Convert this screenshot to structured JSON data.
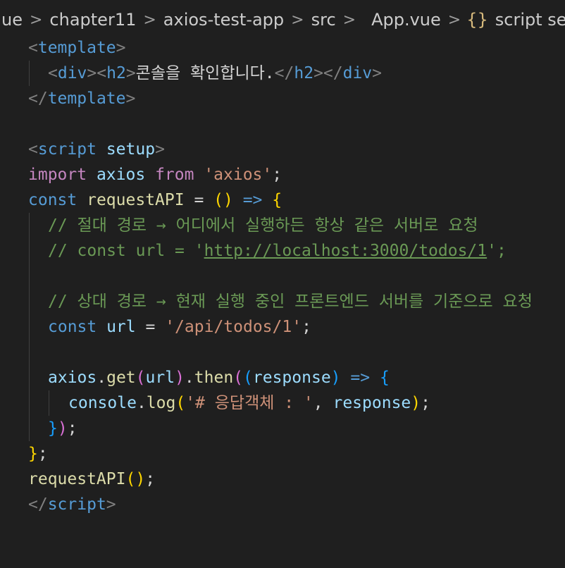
{
  "breadcrumb": {
    "items": [
      "ue",
      "chapter11",
      "axios-test-app",
      "src",
      "App.vue",
      "script se"
    ],
    "braces_icon": "{}",
    "separator": ">"
  },
  "code": {
    "template_open": "template",
    "div": "div",
    "h2": "h2",
    "heading_text": "콘솔을 확인합니다.",
    "script_tag": "script",
    "setup_attr": "setup",
    "import_kw": "import",
    "axios_var": "axios",
    "from_kw": "from",
    "axios_str": "'axios'",
    "const_kw": "const",
    "request_fn": "requestAPI",
    "comment_abs": "// 절대 경로 → 어디에서 실행하든 항상 같은 서버로 요청",
    "comment_const_prefix": "// const url = '",
    "comment_url": "http://localhost:3000/todos/1",
    "comment_const_suffix": "';",
    "comment_rel": "// 상대 경로 → 현재 실행 중인 프론트엔드 서버를 기준으로 요청",
    "url_var": "url",
    "url_str": "'/api/todos/1'",
    "get_fn": "get",
    "then_fn": "then",
    "response_var": "response",
    "console_var": "console",
    "log_fn": "log",
    "log_str": "'# 응답객체 : '"
  },
  "colors": {
    "background": "#1f1f1f",
    "tag": "#569cd6",
    "keyword": "#c586c0",
    "function": "#dcdcaa",
    "variable": "#9cdcfe",
    "string": "#ce9178",
    "comment": "#6a9955"
  },
  "icons": [
    "vue-logo-icon"
  ]
}
